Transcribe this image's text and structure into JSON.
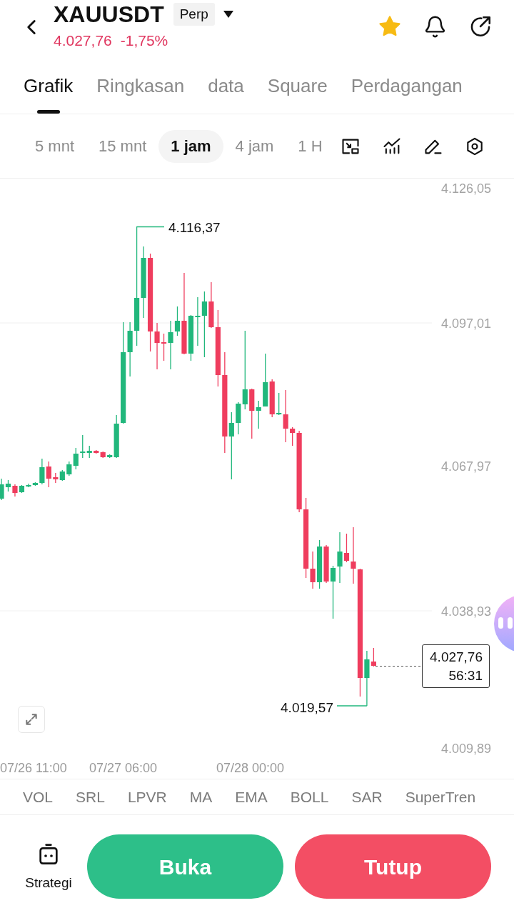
{
  "header": {
    "symbol": "XAUUSDT",
    "contract_tag": "Perp",
    "price": "4.027,76",
    "change": "-1,75%",
    "favorite": true
  },
  "tabs": [
    {
      "label": "Grafik",
      "selected": true
    },
    {
      "label": "Ringkasan",
      "selected": false
    },
    {
      "label": "data",
      "selected": false
    },
    {
      "label": "Square",
      "selected": false
    },
    {
      "label": "Perdagangan",
      "selected": false
    }
  ],
  "timeframes": [
    {
      "label": "5 mnt",
      "selected": false
    },
    {
      "label": "15 mnt",
      "selected": false
    },
    {
      "label": "1 jam",
      "selected": true
    },
    {
      "label": "4 jam",
      "selected": false
    },
    {
      "label": "1 H",
      "selected": false
    }
  ],
  "chart": {
    "price_axis": [
      "4.126,05",
      "4.097,01",
      "4.067,97",
      "4.038,93",
      "4.009,89"
    ],
    "time_axis": [
      "07/26 11:00",
      "07/27 06:00",
      "07/28 00:00"
    ],
    "high_label": "4.116,37",
    "low_label": "4.019,57",
    "last_price": "4.027,76",
    "countdown": "56:31"
  },
  "indicators": [
    "VOL",
    "SRL",
    "LPVR",
    "MA",
    "EMA",
    "BOLL",
    "SAR",
    "SuperTren"
  ],
  "bottom_bar": {
    "strategy_label": "Strategi",
    "buttons": [
      {
        "label": "Buka",
        "kind": "open"
      },
      {
        "label": "Tutup",
        "kind": "close"
      }
    ]
  }
}
